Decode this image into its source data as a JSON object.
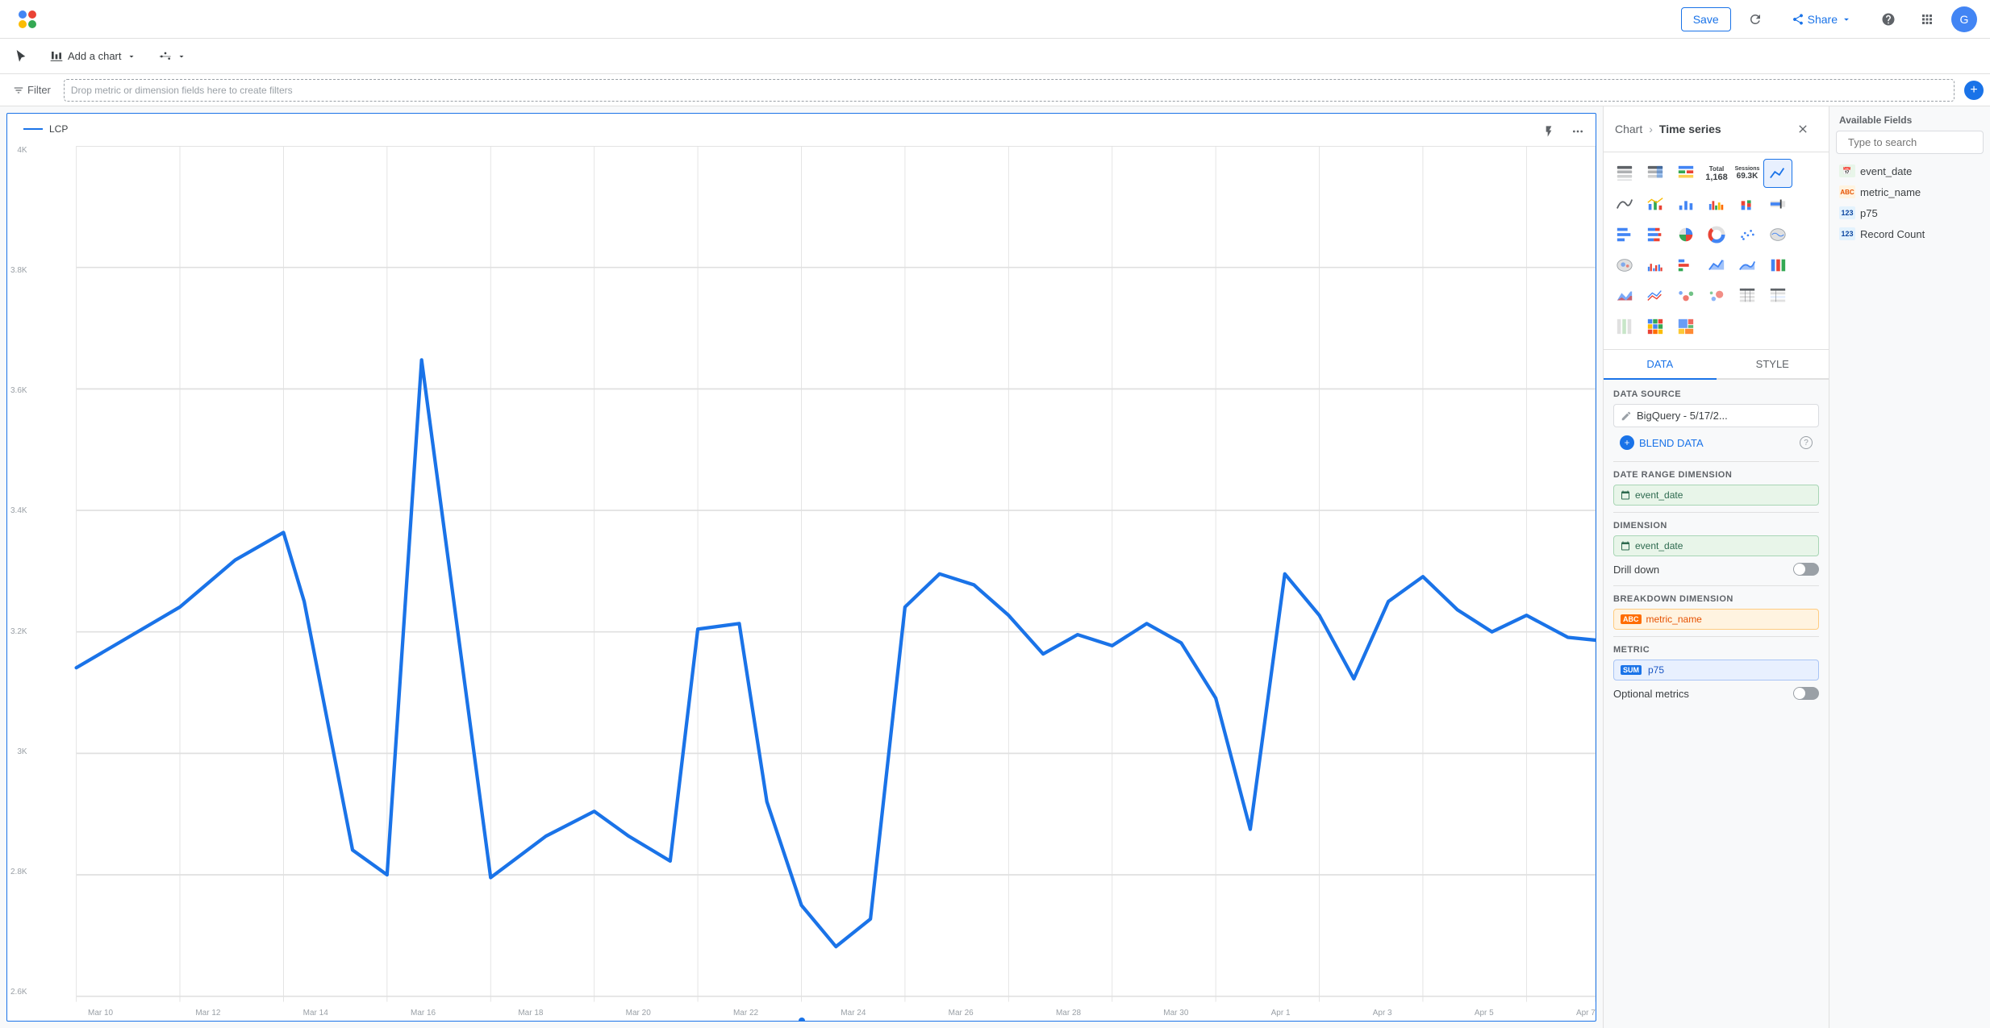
{
  "nav": {
    "save_label": "Save",
    "share_label": "Share",
    "avatar_letter": "G"
  },
  "toolbar": {
    "add_chart_label": "Add a chart",
    "filter_label": "Filter"
  },
  "filter_bar": {
    "drop_zone_text": "Drop metric or dimension fields here to create filters"
  },
  "chart": {
    "legend_label": "LCP",
    "y_labels": [
      "4K",
      "3.8K",
      "3.6K",
      "3.4K",
      "3.2K",
      "3K",
      "2.8K",
      "2.6K"
    ],
    "x_labels": [
      "Mar 10",
      "Mar 12",
      "Mar 14",
      "Mar 16",
      "Mar 18",
      "Mar 20",
      "Mar 22",
      "Mar 24",
      "Mar 26",
      "Mar 28",
      "Mar 30",
      "Apr 1",
      "Apr 3",
      "Apr 5",
      "Apr 7"
    ]
  },
  "right_panel": {
    "title": "Chart",
    "breadcrumb_arrow": ">",
    "subtitle": "Time series",
    "tabs": [
      "DATA",
      "STYLE"
    ],
    "active_tab": "DATA",
    "data_source_label": "Data source",
    "data_source_name": "BigQuery - 5/17/2...",
    "blend_data_label": "BLEND DATA",
    "date_range_dimension_label": "Date Range Dimension",
    "date_range_field": "event_date",
    "dimension_label": "Dimension",
    "dimension_field": "event_date",
    "drill_down_label": "Drill down",
    "breakdown_dimension_label": "Breakdown Dimension",
    "breakdown_field": "metric_name",
    "metric_label": "Metric",
    "metric_field": "p75",
    "metric_agg": "SUM",
    "optional_metrics_label": "Optional metrics",
    "available_fields_label": "Available Fields",
    "search_placeholder": "Type to search",
    "fields": [
      {
        "name": "event_date",
        "type": "date"
      },
      {
        "name": "metric_name",
        "type": "rbc"
      },
      {
        "name": "p75",
        "type": "123"
      },
      {
        "name": "Record Count",
        "type": "123"
      }
    ],
    "chart_types": [
      [
        "table",
        "table-total",
        "table-heat",
        "scorecard-total",
        "scorecard-sessions",
        "time-series"
      ],
      [
        "smooth-line",
        "line",
        "bar",
        "multi-bar",
        "stacked-bar",
        "bullet"
      ],
      [
        "bar-h",
        "bar-stacked-h",
        "pie",
        "donut",
        "scatter",
        "map-geo"
      ],
      [
        "map-bubble",
        "bar-grouped",
        "bar-side",
        "area",
        "area-smooth",
        "bar-norm"
      ],
      [
        "area-filled",
        "line-multi",
        "scatter2",
        "bubble",
        "table2",
        "table3"
      ],
      [
        "table4",
        "heatmap",
        "treemap"
      ]
    ]
  }
}
